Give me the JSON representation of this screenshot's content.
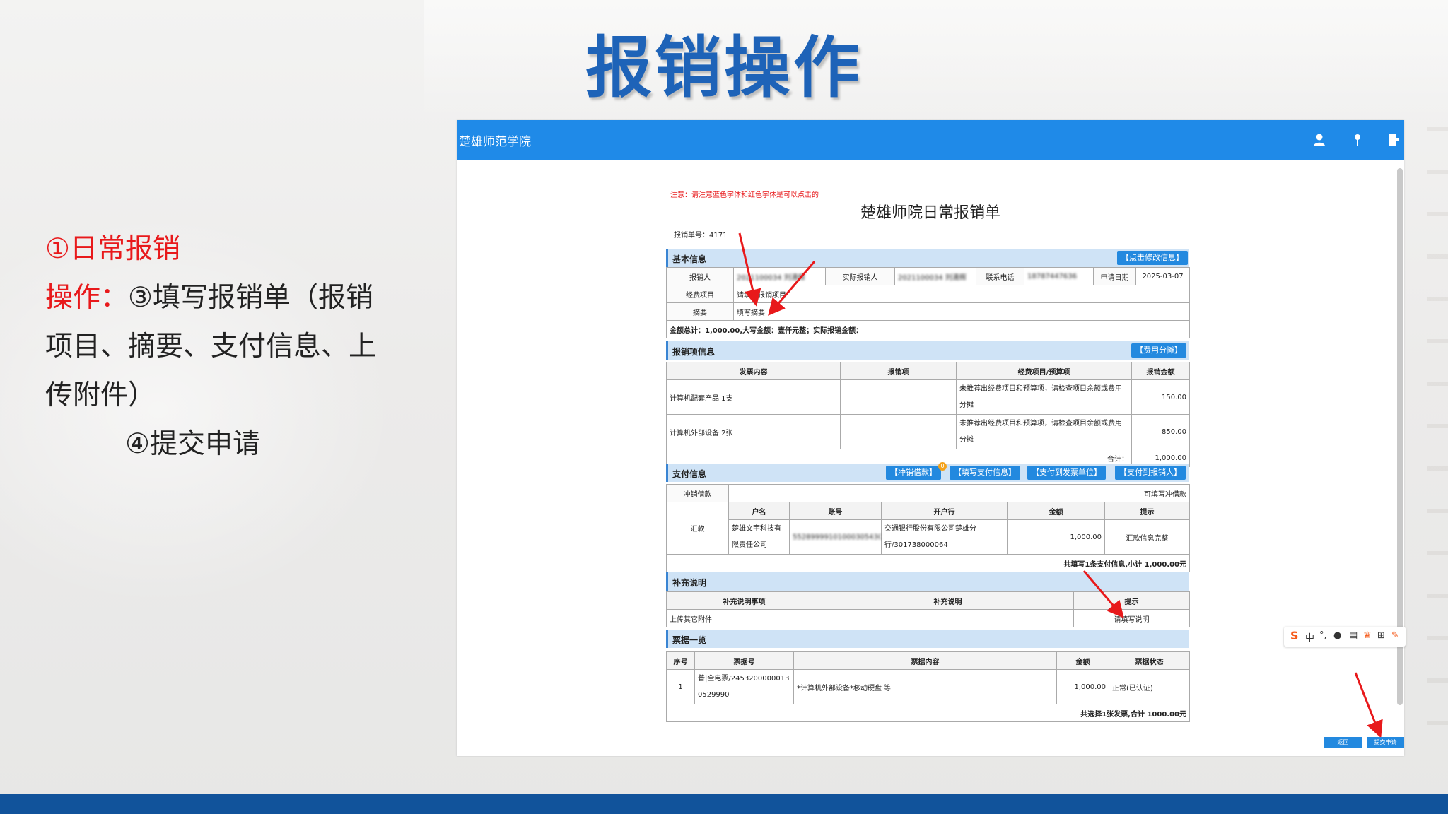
{
  "slide": {
    "title": "报销操作",
    "step_title": "①日常报销",
    "op_label": "操作：",
    "line1": "③填写报销单（报销",
    "line2": "项目、摘要、支付信息、上",
    "line3": "传附件）",
    "line4": "④提交申请"
  },
  "window": {
    "app_title": "楚雄师范学院",
    "icons": [
      "user-icon",
      "pin-icon",
      "logout-icon"
    ]
  },
  "form": {
    "notice": "注意：请注意蓝色字体和红色字体是可以点击的",
    "title": "楚雄师院日常报销单",
    "number_label": "报销单号：4171",
    "basic": {
      "section": "基本信息",
      "edit_btn": "【点击修改信息】",
      "applicant_label": "报销人",
      "applicant_value": "2021100034 刘清辉",
      "actual_label": "实际报销人",
      "actual_value": "2021100034 刘清辉",
      "phone_label": "联系电话",
      "phone_value": "18787447636",
      "date_label": "申请日期",
      "date_value": "2025-03-07",
      "project_label": "经费项目",
      "project_value": "请填写报销项目",
      "summary_label": "摘要",
      "summary_value": "填写摘要",
      "total_line": "金额总计：1,000.00,大写金额：壹仟元整；实际报销金额："
    },
    "items": {
      "section": "报销项信息",
      "split_btn": "【费用分摊】",
      "headers": [
        "发票内容",
        "报销项",
        "经费项目/预算项",
        "报销金额"
      ],
      "rows": [
        {
          "content": "计算机配套产品 1支",
          "item": "",
          "project": "未推荐出经费项目和预算项，请检查项目余额或费用分摊",
          "amount": "150.00"
        },
        {
          "content": "计算机外部设备 2张",
          "item": "",
          "project": "未推荐出经费项目和预算项，请检查项目余额或费用分摊",
          "amount": "850.00"
        }
      ],
      "total_label": "合计：",
      "total_value": "1,000.00"
    },
    "payment": {
      "section": "支付信息",
      "btn_offset": "【冲销借款】",
      "btn_badge": "0",
      "btn_fill": "【填写支付信息】",
      "btn_invoice": "【支付到发票单位】",
      "btn_person": "【支付到报销人】",
      "offset_label": "冲销借款",
      "offset_link": "可填写冲借款",
      "remit_label": "汇款",
      "headers": [
        "户名",
        "账号",
        "开户行",
        "金额",
        "提示"
      ],
      "account_name": "楚雄文宇科技有限责任公司",
      "account_no": "5528999910100030543021",
      "bank": "交通银行股份有限公司楚雄分行/301738000064",
      "amount": "1,000.00",
      "tip": "汇款信息完整",
      "summary": "共填写1条支付信息,小计 1,000.00元"
    },
    "supplement": {
      "section": "补充说明",
      "headers": [
        "补充说明事项",
        "补充说明",
        "提示"
      ],
      "row_label": "上传其它附件",
      "row_value": "",
      "row_tip": "请填写说明"
    },
    "invoices": {
      "section": "票据一览",
      "headers": [
        "序号",
        "票据号",
        "票据内容",
        "金额",
        "票据状态"
      ],
      "rows": [
        {
          "no": "1",
          "number": "普|全电票/24532000000130529990",
          "content": "*计算机外部设备*移动硬盘 等",
          "amount": "1,000.00",
          "status": "正常(已认证)"
        }
      ],
      "summary": "共选择1张发票,合计 1000.00元"
    },
    "back_btn": "返回",
    "submit_btn": "提交申请"
  },
  "ime": {
    "logo": "S",
    "lang": "中"
  },
  "colors": {
    "title_blue": "#1e63b8",
    "header_blue": "#1f8ae8",
    "red": "#e8191b",
    "band": "#11539b"
  }
}
